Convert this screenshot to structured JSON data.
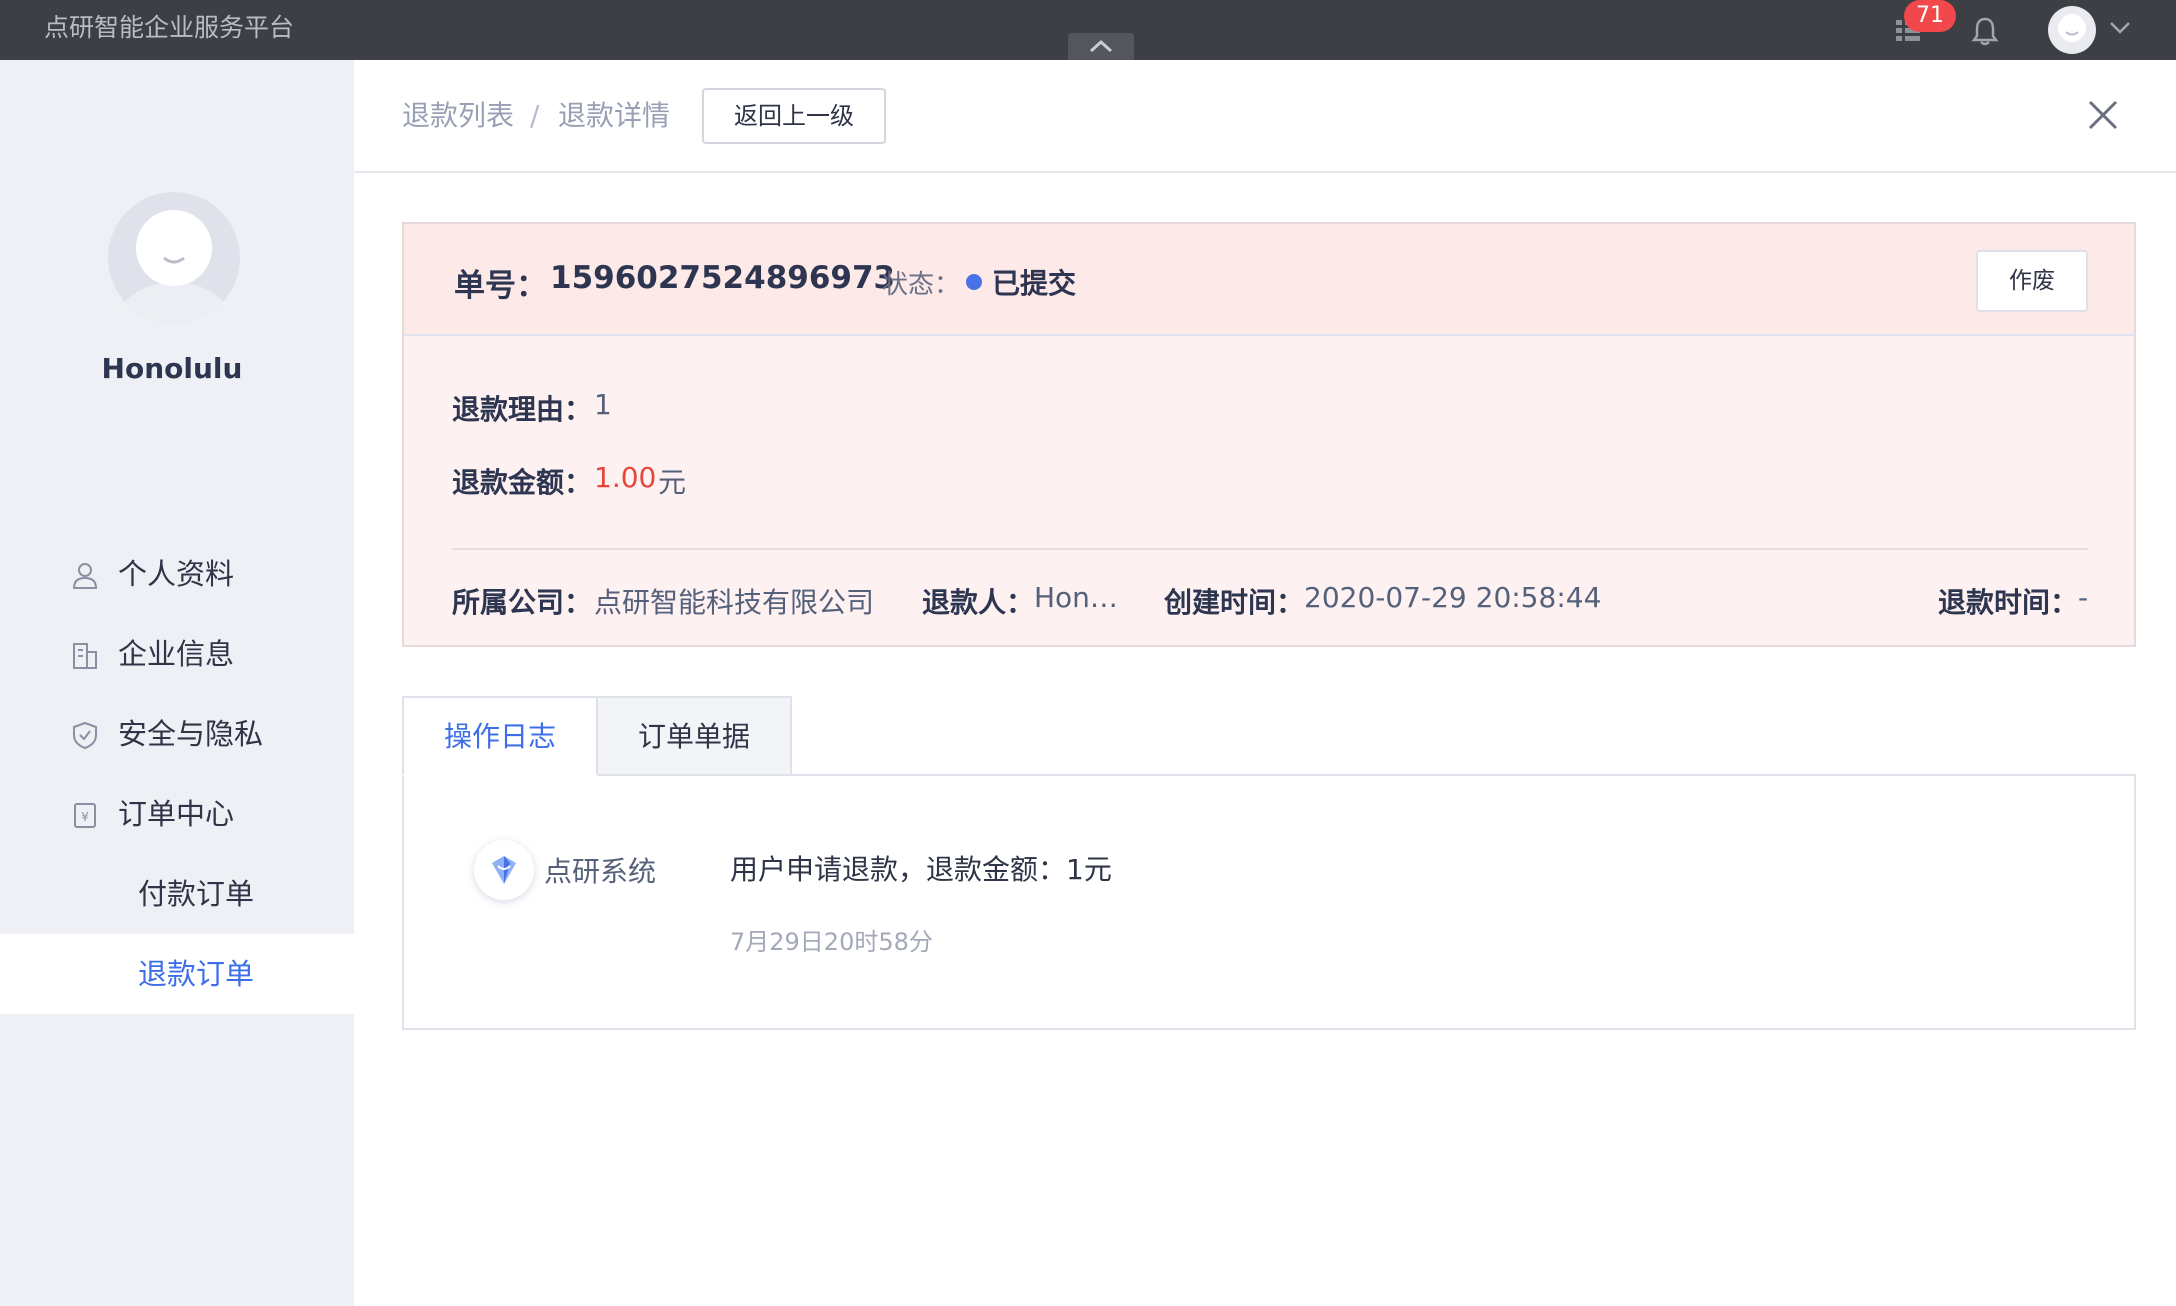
{
  "topbar": {
    "app_title": "点研智能企业服务平台",
    "badge_count": "71"
  },
  "sidebar": {
    "username": "Honolulu",
    "items": [
      {
        "label": "个人资料",
        "icon": "user-icon"
      },
      {
        "label": "企业信息",
        "icon": "building-icon"
      },
      {
        "label": "安全与隐私",
        "icon": "shield-icon"
      },
      {
        "label": "订单中心",
        "icon": "order-icon"
      }
    ],
    "sub_items": [
      {
        "label": "付款订单",
        "active": false
      },
      {
        "label": "退款订单",
        "active": true
      }
    ]
  },
  "breadcrumb": {
    "items": [
      "退款列表",
      "退款详情"
    ],
    "separator": "/",
    "back_label": "返回上一级"
  },
  "card": {
    "order_label": "单号：",
    "order_no": "1596027524896973",
    "status_label": "状态：",
    "status_value": "已提交",
    "void_label": "作废",
    "reason_label": "退款理由：",
    "reason_value": "1",
    "amount_label": "退款金额：",
    "amount_value": "1.00",
    "amount_unit": "元",
    "company_label": "所属公司：",
    "company_value": "点研智能科技有限公司",
    "refunder_label": "退款人：",
    "refunder_value": "Hon…",
    "created_label": "创建时间：",
    "created_value": "2020-07-29 20:58:44",
    "refund_time_label": "退款时间：",
    "refund_time_value": "-"
  },
  "tabs": [
    {
      "label": "操作日志",
      "active": true
    },
    {
      "label": "订单单据",
      "active": false
    }
  ],
  "log": {
    "actor": "点研系统",
    "text": "用户申请退款，退款金额：1元",
    "time": "7月29日20时58分"
  },
  "colors": {
    "accent": "#3f6fe8",
    "danger": "#e8463b",
    "topbar": "#3d3f45",
    "sidebar": "#eef0f5"
  }
}
